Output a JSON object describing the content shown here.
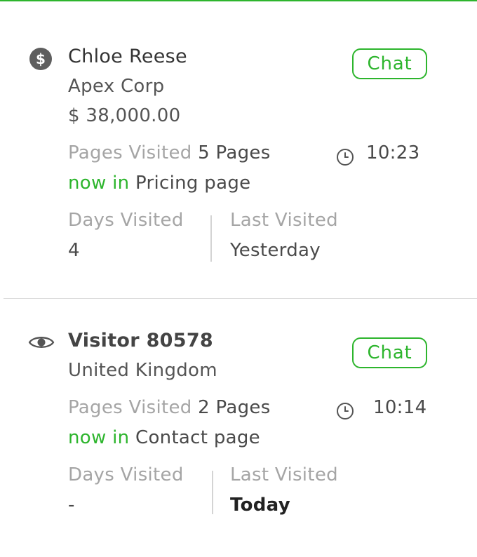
{
  "colors": {
    "accent": "#2db52d",
    "muted_text": "#a5a5a5",
    "primary_text": "#444444",
    "divider": "#dddddd"
  },
  "visitors": [
    {
      "type_icon": "dollar-icon",
      "name": "Chloe Reese",
      "company": "Apex Corp",
      "value": "$ 38,000.00",
      "chat_label": "Chat",
      "pages_visited_label": "Pages Visited",
      "pages_visited_value": "5 Pages",
      "time_icon": "clock-icon",
      "time": "10:23",
      "now_in_label": "now in",
      "now_in_value": "Pricing page",
      "days_visited_label": "Days Visited",
      "days_visited_value": "4",
      "last_visited_label": "Last Visited",
      "last_visited_value": "Yesterday"
    },
    {
      "type_icon": "eye-icon",
      "name": "Visitor 80578",
      "location": "United Kingdom",
      "chat_label": "Chat",
      "pages_visited_label": "Pages Visited",
      "pages_visited_value": "2 Pages",
      "time_icon": "clock-icon",
      "time": "10:14",
      "now_in_label": "now in",
      "now_in_value": "Contact page",
      "days_visited_label": "Days Visited",
      "days_visited_value": "-",
      "last_visited_label": "Last Visited",
      "last_visited_value": "Today"
    }
  ]
}
